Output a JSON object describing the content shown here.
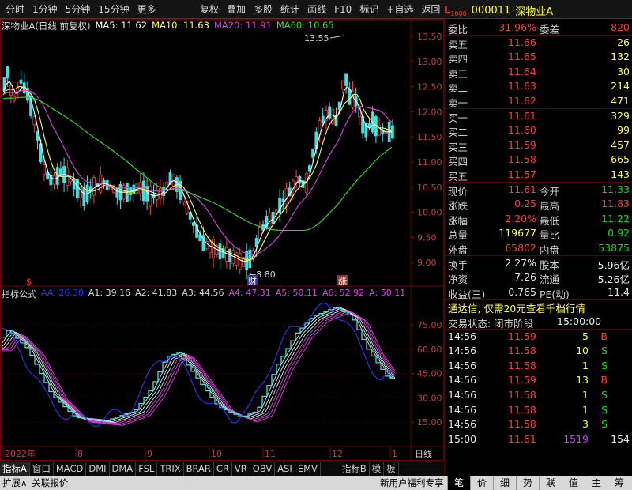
{
  "toolbar": {
    "left": [
      "分时",
      "1分钟",
      "5分钟",
      "15分钟",
      "更多"
    ],
    "right": [
      "复权",
      "叠加",
      "多股",
      "统计",
      "画线",
      "F10",
      "标记",
      "+自选",
      "返回"
    ]
  },
  "stock": {
    "market_badge": "L",
    "market_sub": "1000",
    "code": "000011",
    "name": "深物业A"
  },
  "ma_legend": {
    "title": "深物业A(日线 前复权)",
    "items": [
      {
        "label": "MA5: 11.62",
        "color": "#ffffff"
      },
      {
        "label": "MA10: 11.63",
        "color": "#ffff40"
      },
      {
        "label": "MA20: 11.91",
        "color": "#e040e0"
      },
      {
        "label": "MA60: 10.65",
        "color": "#30e030"
      }
    ]
  },
  "ind_legend": {
    "title": "指标公式",
    "items": [
      {
        "label": "AA: 26.30",
        "color": "#3030ff"
      },
      {
        "label": "A1: 39.16",
        "color": "#d8d8d8"
      },
      {
        "label": "A2: 41.83",
        "color": "#d8d8d8"
      },
      {
        "label": "A3: 44.56",
        "color": "#d8d8d8"
      },
      {
        "label": "A4: 47.31",
        "color": "#e040e0"
      },
      {
        "label": "A5: 50.11",
        "color": "#e040e0"
      },
      {
        "label": "A6: 52.92",
        "color": "#e040e0"
      },
      {
        "label": "A: 50.11",
        "color": "#e040e0"
      }
    ]
  },
  "chart_data": {
    "type": "candlestick",
    "price_axis": [
      "13.50",
      "13.00",
      "12.50",
      "12.00",
      "11.50",
      "11.00",
      "10.50",
      "10.00",
      "9.50",
      "9.00"
    ],
    "ind_axis": [
      "75.00",
      "60.00",
      "45.00",
      "30.00",
      "15.00"
    ],
    "date_axis": [
      {
        "label": "2022年"
      },
      {
        "label": "8"
      },
      {
        "label": "9"
      },
      {
        "label": "10"
      },
      {
        "label": "11"
      },
      {
        "label": "12"
      },
      {
        "label": "1"
      }
    ],
    "date_axis_right": "日线",
    "annotations": {
      "high": "13.55",
      "low": "8.80",
      "mark_s": "$",
      "mark_cai": "财",
      "mark_zhang": "涨"
    },
    "series": [
      {
        "name": "MA5",
        "color": "#ffffff"
      },
      {
        "name": "MA10",
        "color": "#ffff40"
      },
      {
        "name": "MA20",
        "color": "#e040e0"
      },
      {
        "name": "MA60",
        "color": "#30e030"
      }
    ]
  },
  "quote": {
    "weibi": {
      "label": "委比",
      "value": "31.96%",
      "label2": "委差",
      "value2": "820"
    },
    "sells": [
      {
        "label": "卖五",
        "price": "11.66",
        "vol": "26"
      },
      {
        "label": "卖四",
        "price": "11.65",
        "vol": "132"
      },
      {
        "label": "卖三",
        "price": "11.64",
        "vol": "30"
      },
      {
        "label": "卖二",
        "price": "11.63",
        "vol": "214"
      },
      {
        "label": "卖一",
        "price": "11.62",
        "vol": "471"
      }
    ],
    "buys": [
      {
        "label": "买一",
        "price": "11.61",
        "vol": "329"
      },
      {
        "label": "买二",
        "price": "11.60",
        "vol": "99"
      },
      {
        "label": "买三",
        "price": "11.59",
        "vol": "457"
      },
      {
        "label": "买四",
        "price": "11.58",
        "vol": "665"
      },
      {
        "label": "买五",
        "price": "11.57",
        "vol": "143"
      }
    ],
    "stats": [
      {
        "l1": "现价",
        "v1": "11.61",
        "c1": "red",
        "l2": "今开",
        "v2": "11.33",
        "c2": "green"
      },
      {
        "l1": "涨跌",
        "v1": "0.25",
        "c1": "red",
        "l2": "最高",
        "v2": "11.83",
        "c2": "red"
      },
      {
        "l1": "涨幅",
        "v1": "2.20%",
        "c1": "red",
        "l2": "最低",
        "v2": "11.22",
        "c2": "green"
      },
      {
        "l1": "总量",
        "v1": "119677",
        "c1": "yellow",
        "l2": "量比",
        "v2": "0.92",
        "c2": "green"
      },
      {
        "l1": "外盘",
        "v1": "65802",
        "c1": "red",
        "l2": "内盘",
        "v2": "53875",
        "c2": "green"
      }
    ],
    "stats2": [
      {
        "l1": "换手",
        "v1": "2.27%",
        "l2": "股本",
        "v2": "5.96亿"
      },
      {
        "l1": "净资",
        "v1": "7.26",
        "l2": "流通",
        "v2": "5.26亿"
      },
      {
        "l1": "收益(三)",
        "v1": "0.765",
        "l2": "PE(动)",
        "v2": "11.4"
      }
    ],
    "promo": "通达信, 仅需20元查看千档行情",
    "trade_state_label": "交易状态: 闭市阶段",
    "trade_state_time": "15:00:00",
    "ticks": [
      {
        "time": "14:56",
        "price": "11.59",
        "vol": "5",
        "side": "B"
      },
      {
        "time": "14:56",
        "price": "11.58",
        "vol": "10",
        "side": "S"
      },
      {
        "time": "14:56",
        "price": "11.58",
        "vol": "1",
        "side": "S"
      },
      {
        "time": "14:56",
        "price": "11.59",
        "vol": "13",
        "side": "B"
      },
      {
        "time": "14:56",
        "price": "11.58",
        "vol": "1",
        "side": "S"
      },
      {
        "time": "14:56",
        "price": "11.58",
        "vol": "1",
        "side": "S"
      },
      {
        "time": "14:56",
        "price": "11.58",
        "vol": "3",
        "side": "S"
      },
      {
        "time": "15:00",
        "price": "11.61",
        "vol": "1519",
        "side": "154"
      }
    ]
  },
  "bottom_tabs": [
    "指标A",
    "窗口",
    "MACD",
    "DMI",
    "DMA",
    "FSL",
    "TRIX",
    "BRAR",
    "CR",
    "VR",
    "OBV",
    "ASI",
    "EMV",
    "指标B",
    "模",
    "板"
  ],
  "status_bar": {
    "left": [
      "扩展∧",
      "关联报价"
    ],
    "right_text": "新用户福利专享"
  },
  "right_tabs": [
    "笔",
    "价",
    "细",
    "势",
    "联",
    "值",
    "主",
    "筹"
  ]
}
